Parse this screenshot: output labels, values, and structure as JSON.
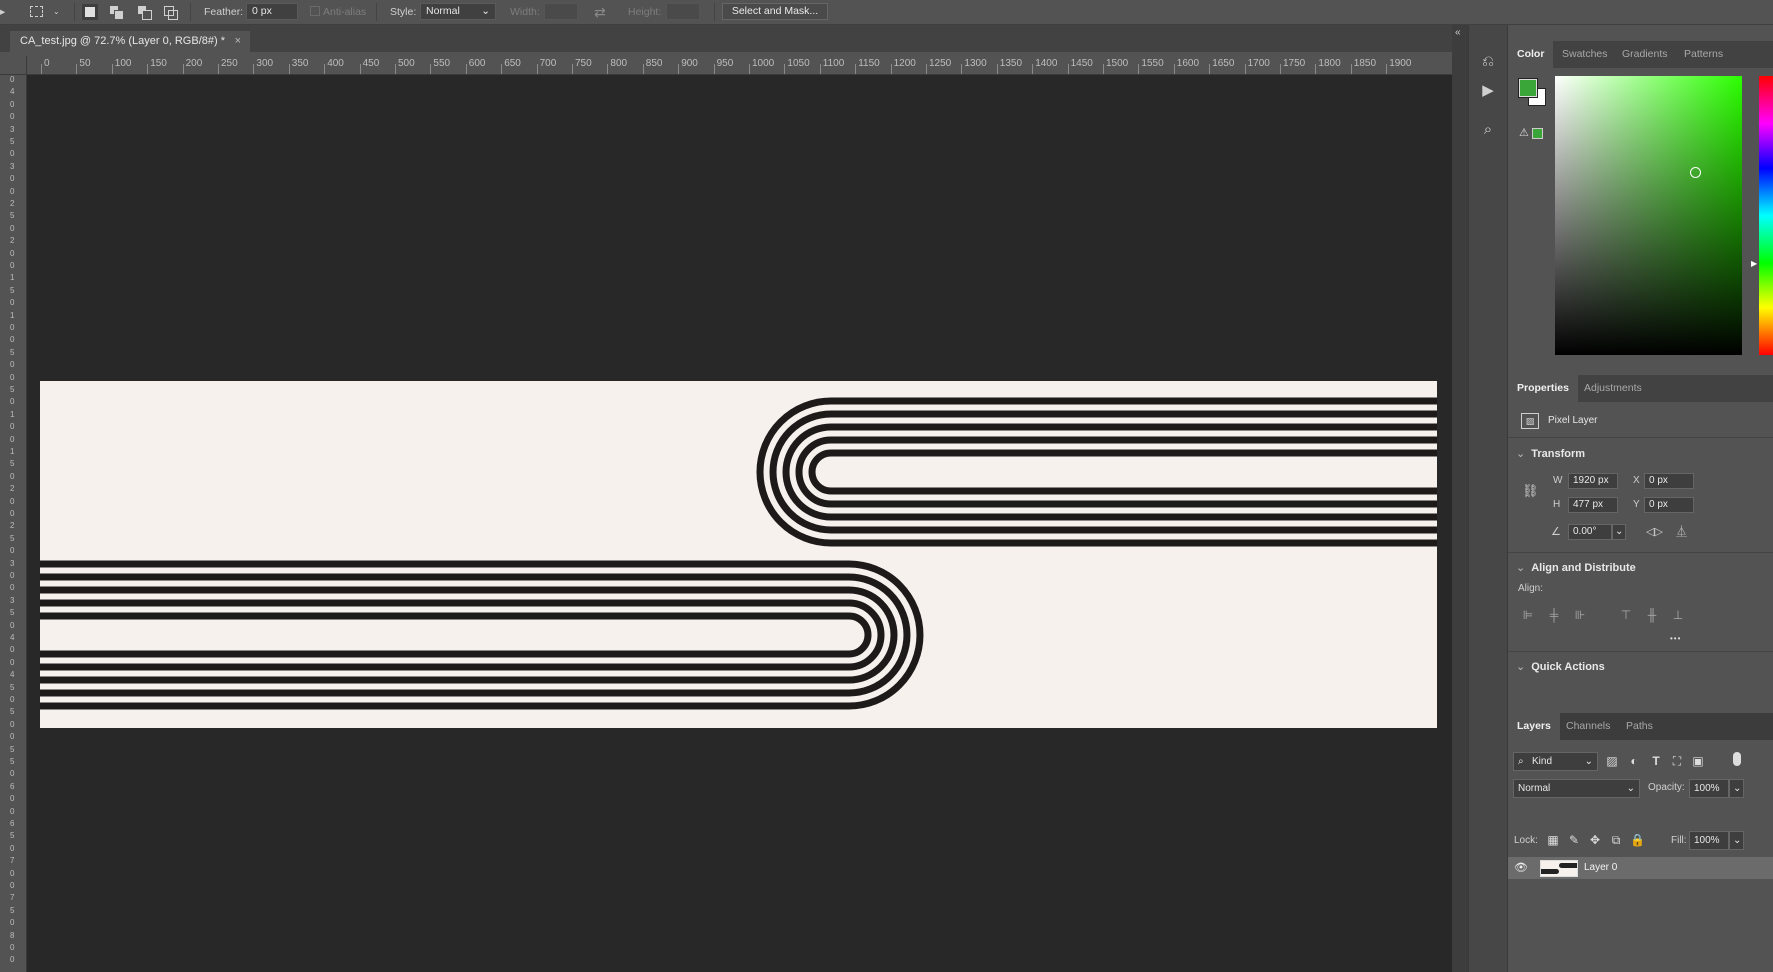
{
  "options_bar": {
    "feather_label": "Feather:",
    "feather_value": "0 px",
    "antialias_label": "Anti-alias",
    "style_label": "Style:",
    "style_value": "Normal",
    "width_label": "Width:",
    "height_label": "Height:",
    "select_mask_label": "Select and Mask..."
  },
  "document": {
    "tab_title": "CA_test.jpg @ 72.7% (Layer 0, RGB/8#) *",
    "close_glyph": "×"
  },
  "ruler": {
    "top_ticks": [
      "0",
      "50",
      "100",
      "150",
      "200",
      "250",
      "300",
      "350",
      "400",
      "450",
      "500",
      "550",
      "600",
      "650",
      "700",
      "750",
      "800",
      "850",
      "900",
      "950",
      "1000",
      "1050",
      "1100",
      "1150",
      "1200",
      "1250",
      "1300",
      "1350",
      "1400",
      "1450",
      "1500",
      "1550",
      "1600",
      "1650",
      "1700",
      "1750",
      "1800",
      "1850",
      "1900"
    ],
    "left_ticks": [
      "0",
      "4",
      "0",
      "0",
      "3",
      "5",
      "0",
      "3",
      "0",
      "0",
      "2",
      "5",
      "0",
      "2",
      "0",
      "0",
      "1",
      "5",
      "0",
      "1",
      "0",
      "0",
      "5",
      "0",
      "0",
      "5",
      "0",
      "1",
      "0",
      "0",
      "1",
      "5",
      "0",
      "2",
      "0",
      "0",
      "2",
      "5",
      "0",
      "3",
      "0",
      "0",
      "3",
      "5",
      "0",
      "4",
      "0",
      "0",
      "4",
      "5",
      "0",
      "5",
      "0",
      "0",
      "5",
      "5",
      "0",
      "6",
      "0",
      "0",
      "6",
      "5",
      "0",
      "7",
      "0",
      "0",
      "7",
      "5",
      "0",
      "8",
      "0",
      "0"
    ]
  },
  "color_panel": {
    "tabs": [
      "Color",
      "Swatches",
      "Gradients",
      "Patterns"
    ],
    "foreground": "#3aa639",
    "background": "#ffffff",
    "hue_color": "#2bff00"
  },
  "properties_panel": {
    "tabs": [
      "Properties",
      "Adjustments"
    ],
    "layer_type": "Pixel Layer",
    "transform_title": "Transform",
    "w_label": "W",
    "w_value": "1920 px",
    "h_label": "H",
    "h_value": "477 px",
    "x_label": "X",
    "x_value": "0 px",
    "y_label": "Y",
    "y_value": "0 px",
    "angle_value": "0.00°",
    "align_title": "Align and Distribute",
    "align_label": "Align:",
    "more_glyph": "•••",
    "quick_actions_title": "Quick Actions"
  },
  "layers_panel": {
    "tabs": [
      "Layers",
      "Channels",
      "Paths"
    ],
    "filter_value": "Kind",
    "blend_mode": "Normal",
    "opacity_label": "Opacity:",
    "opacity_value": "100%",
    "lock_label": "Lock:",
    "fill_label": "Fill:",
    "fill_value": "100%",
    "layer_name": "Layer 0"
  }
}
